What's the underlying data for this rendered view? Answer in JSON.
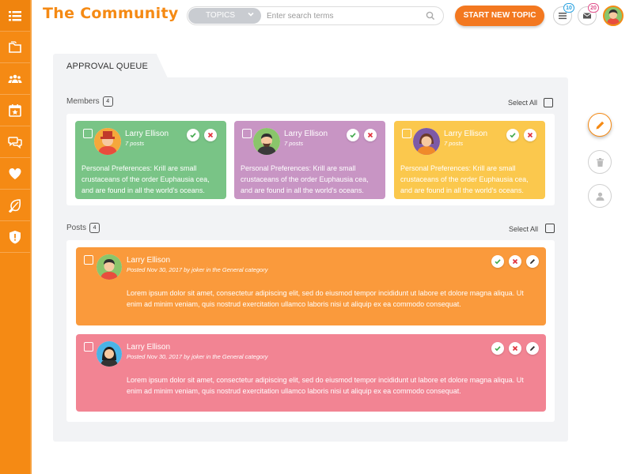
{
  "app": {
    "title": "The Community"
  },
  "colors": {
    "accent": "#f58a14",
    "start_button": "#f37820",
    "green_card": "#79c486",
    "purple_card": "#c895c4",
    "yellow_card": "#fbc84d",
    "orange_post": "#fa9a3c",
    "pink_post": "#f28493"
  },
  "sidebar": {
    "items": [
      {
        "icon": "menu-icon"
      },
      {
        "icon": "folder-icon"
      },
      {
        "icon": "group-icon"
      },
      {
        "icon": "calendar-star-icon"
      },
      {
        "icon": "chat-bubbles-icon"
      },
      {
        "icon": "heart-icon"
      },
      {
        "icon": "leaf-icon"
      },
      {
        "icon": "shield-icon"
      }
    ]
  },
  "header": {
    "search": {
      "category": "TOPICS",
      "placeholder": "Enter search terms"
    },
    "start_button": "START NEW TOPIC",
    "notifications_count": "10",
    "messages_count": "20"
  },
  "queue": {
    "tab_label": "APPROVAL QUEUE",
    "members": {
      "title": "Members",
      "count": "4",
      "select_all": "Select All",
      "cards": [
        {
          "name": "Larry Ellison",
          "posts": "7 posts",
          "description": "Personal Preferences: Krill are small crustaceans of the order Euphausia cea, and are found in all the world's oceans."
        },
        {
          "name": "Larry Ellison",
          "posts": "7 posts",
          "description": "Personal Preferences: Krill are small crustaceans of the order Euphausia cea, and are found in all the world's oceans."
        },
        {
          "name": "Larry Ellison",
          "posts": "7 posts",
          "description": "Personal Preferences: Krill are small crustaceans of the order Euphausia cea, and are found in all the world's oceans."
        }
      ]
    },
    "posts": {
      "title": "Posts",
      "count": "4",
      "select_all": "Select All",
      "cards": [
        {
          "name": "Larry Ellison",
          "meta": "Posted Nov 30, 2017 by joker in the General category",
          "body": "Lorem ipsum dolor sit amet, consectetur adipiscing elit, sed do eiusmod tempor incididunt ut labore et dolore magna aliqua. Ut enim ad minim veniam, quis nostrud exercitation ullamco laboris nisi ut aliquip ex ea commodo consequat."
        },
        {
          "name": "Larry Ellison",
          "meta": "Posted Nov 30, 2017 by joker in the General category",
          "body": "Lorem ipsum dolor sit amet, consectetur adipiscing elit, sed do eiusmod tempor incididunt ut labore et dolore magna aliqua. Ut enim ad minim veniam, quis nostrud exercitation ullamco laboris nisi ut aliquip ex ea commodo consequat."
        }
      ]
    }
  },
  "side_actions": [
    {
      "icon": "pencil-icon"
    },
    {
      "icon": "trash-icon"
    },
    {
      "icon": "user-icon"
    }
  ]
}
